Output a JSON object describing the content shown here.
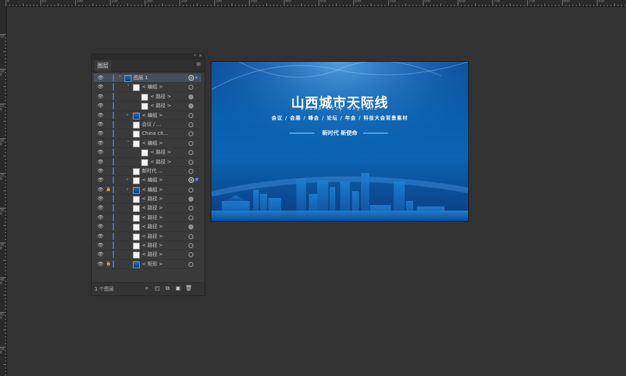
{
  "rulers": {
    "top_labels": [
      "0",
      "50",
      "100",
      "150",
      "200",
      "250",
      "300",
      "350",
      "400",
      "450",
      "500",
      "550",
      "600",
      "650",
      "700",
      "750",
      "800",
      "850"
    ],
    "left_labels": [
      "50",
      "100",
      "150",
      "200",
      "250",
      "300",
      "350",
      "400",
      "450",
      "500"
    ]
  },
  "panel": {
    "collapse_glyph": "«",
    "close_glyph": "×",
    "tab_label": "图层",
    "menu_glyph": "≡",
    "footer_count": "1 个图层",
    "layers": [
      {
        "name": "图层 1",
        "indent": 0,
        "twist": "down",
        "thumb": "blue",
        "lock": false,
        "target": "ring",
        "selected": true,
        "sel": "dot"
      },
      {
        "name": "< 编组 >",
        "indent": 1,
        "twist": "down",
        "thumb": "white",
        "lock": false,
        "target": "empty"
      },
      {
        "name": "< 路径 >",
        "indent": 2,
        "twist": "",
        "thumb": "white",
        "lock": false,
        "target": "filled"
      },
      {
        "name": "< 路径 >",
        "indent": 2,
        "twist": "",
        "thumb": "white",
        "lock": false,
        "target": "filled"
      },
      {
        "name": "< 编组 >",
        "indent": 1,
        "twist": "right",
        "thumb": "blue",
        "lock": false,
        "target": "empty"
      },
      {
        "name": "会议 / ...",
        "indent": 1,
        "twist": "",
        "thumb": "white",
        "lock": false,
        "target": "empty"
      },
      {
        "name": "China cit...",
        "indent": 1,
        "twist": "",
        "thumb": "white",
        "lock": false,
        "target": "empty"
      },
      {
        "name": "< 编组 >",
        "indent": 1,
        "twist": "down",
        "thumb": "white",
        "lock": false,
        "target": "empty"
      },
      {
        "name": "< 路径 >",
        "indent": 2,
        "twist": "",
        "thumb": "white",
        "lock": false,
        "target": "empty"
      },
      {
        "name": "< 路径 >",
        "indent": 2,
        "twist": "",
        "thumb": "white",
        "lock": false,
        "target": "empty"
      },
      {
        "name": "新时代  ...",
        "indent": 1,
        "twist": "",
        "thumb": "white",
        "lock": false,
        "target": "empty"
      },
      {
        "name": "< 编组 >",
        "indent": 1,
        "twist": "right",
        "thumb": "white",
        "lock": false,
        "target": "ring",
        "sel": "square"
      },
      {
        "name": "< 编组 >",
        "indent": 1,
        "twist": "right",
        "thumb": "blue",
        "lock": true,
        "target": "empty"
      },
      {
        "name": "< 路径 >",
        "indent": 1,
        "twist": "",
        "thumb": "white",
        "lock": false,
        "target": "filled"
      },
      {
        "name": "< 路径 >",
        "indent": 1,
        "twist": "",
        "thumb": "white",
        "lock": false,
        "target": "empty"
      },
      {
        "name": "< 路径 >",
        "indent": 1,
        "twist": "",
        "thumb": "white",
        "lock": false,
        "target": "empty"
      },
      {
        "name": "< 路径 >",
        "indent": 1,
        "twist": "",
        "thumb": "white",
        "lock": false,
        "target": "filled"
      },
      {
        "name": "< 路径 >",
        "indent": 1,
        "twist": "",
        "thumb": "white",
        "lock": false,
        "target": "empty"
      },
      {
        "name": "< 路径 >",
        "indent": 1,
        "twist": "",
        "thumb": "white",
        "lock": false,
        "target": "empty"
      },
      {
        "name": "< 路径 >",
        "indent": 1,
        "twist": "",
        "thumb": "white",
        "lock": false,
        "target": "empty"
      },
      {
        "name": "< 矩形 >",
        "indent": 1,
        "twist": "",
        "thumb": "blue",
        "lock": true,
        "target": "empty"
      }
    ],
    "footer_buttons": [
      {
        "name": "locate-object-icon",
        "glyph": "⌕"
      },
      {
        "name": "make-clipping-mask-icon",
        "glyph": "◰"
      },
      {
        "name": "create-sublayer-icon",
        "glyph": "⧉"
      },
      {
        "name": "new-layer-icon",
        "glyph": "▣"
      },
      {
        "name": "delete-layer-icon",
        "glyph": "🗑"
      }
    ]
  },
  "artboard": {
    "title": "山西城市天际线",
    "subtitle": "China city skyline",
    "categories": "会议 / 会展 / 峰会 / 论坛 / 年会 / 科技大会背景素材",
    "slogan": "新时代  新使命"
  },
  "colors": {
    "canvas_bg": "#323232",
    "panel_bg": "#3a3a3a",
    "layer_color": "#4d6bd6",
    "art_blue": "#0b63b3"
  }
}
